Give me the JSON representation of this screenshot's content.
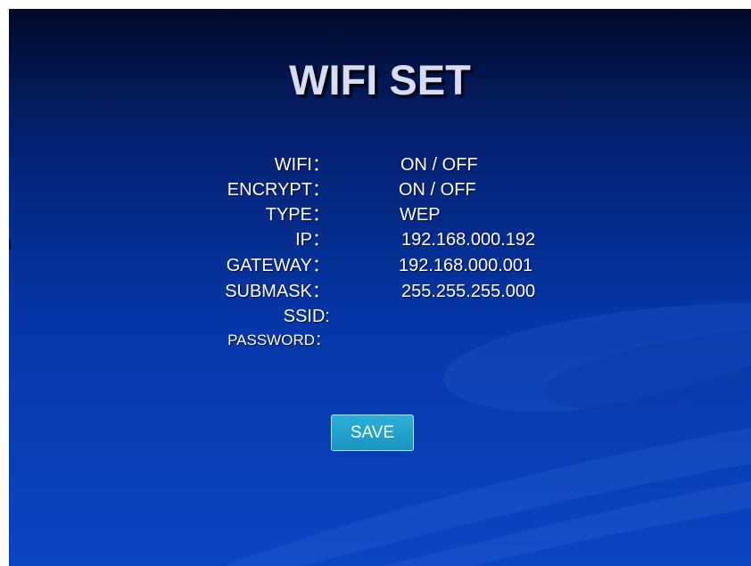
{
  "title": "WIFI SET",
  "fields": {
    "wifi": {
      "label": "WIFI：",
      "value": "ON / OFF"
    },
    "encrypt": {
      "label": "ENCRYPT：",
      "value": "ON / OFF"
    },
    "type": {
      "label": "TYPE：",
      "value": "WEP"
    },
    "ip": {
      "label": "IP：",
      "value": "192.168.000.192"
    },
    "gateway": {
      "label": "GATEWAY：",
      "value": "192.168.000.001"
    },
    "submask": {
      "label": "SUBMASK：",
      "value": "255.255.255.000"
    },
    "ssid": {
      "label": "SSID:",
      "value": ""
    },
    "password": {
      "label": "PASSWORD：",
      "value": ""
    }
  },
  "save_label": "SAVE",
  "colors": {
    "background_top": "#020a28",
    "background_bottom": "#0a45c4",
    "button": "#1fa3cf",
    "text": "#ffffff"
  }
}
